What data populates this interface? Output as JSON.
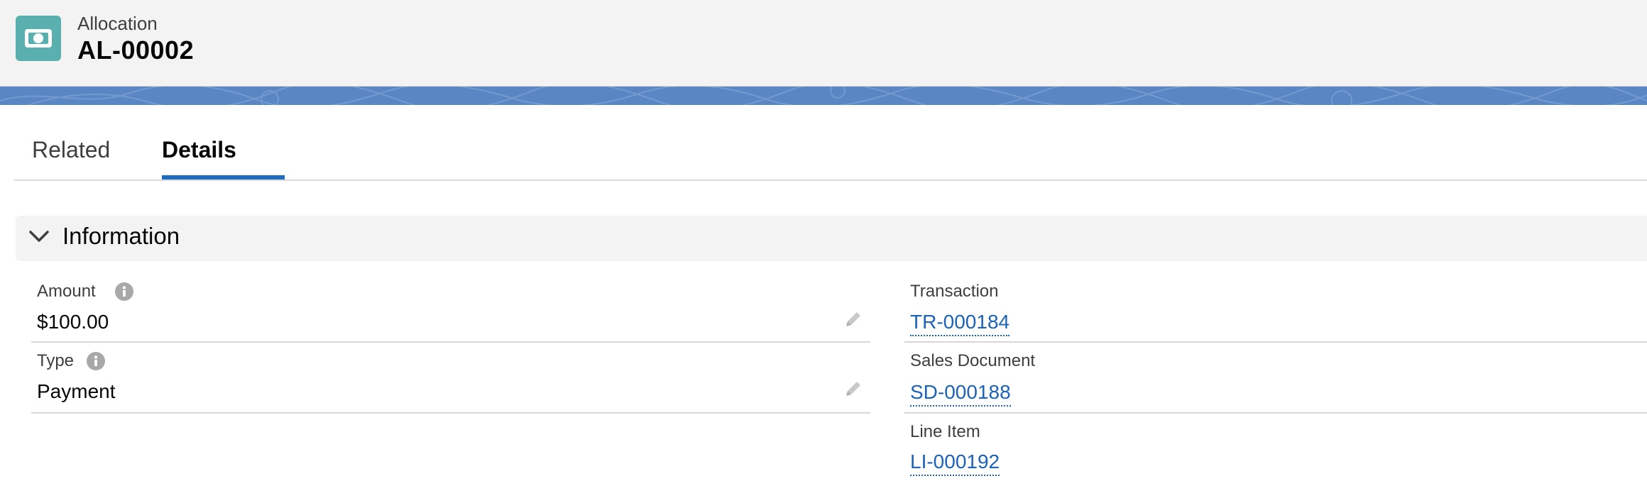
{
  "header": {
    "object_type": "Allocation",
    "record_name": "AL-00002",
    "icon": "money-icon",
    "icon_color": "#5ab0af"
  },
  "banner": {
    "color": "#5a87c4"
  },
  "tabs": [
    {
      "label": "Related",
      "active": false
    },
    {
      "label": "Details",
      "active": true
    }
  ],
  "accent_color": "#1b6ec2",
  "section": {
    "title": "Information",
    "expanded": true
  },
  "left_fields": [
    {
      "label": "Amount",
      "value": "$100.00",
      "info_icon": true,
      "editable": true
    },
    {
      "label": "Type",
      "value": "Payment",
      "info_icon": true,
      "editable": true
    }
  ],
  "right_fields": [
    {
      "label": "Transaction",
      "value": "TR-000184",
      "link": true
    },
    {
      "label": "Sales Document",
      "value": "SD-000188",
      "link": true
    },
    {
      "label": "Line Item",
      "value": "LI-000192",
      "link": true
    }
  ]
}
